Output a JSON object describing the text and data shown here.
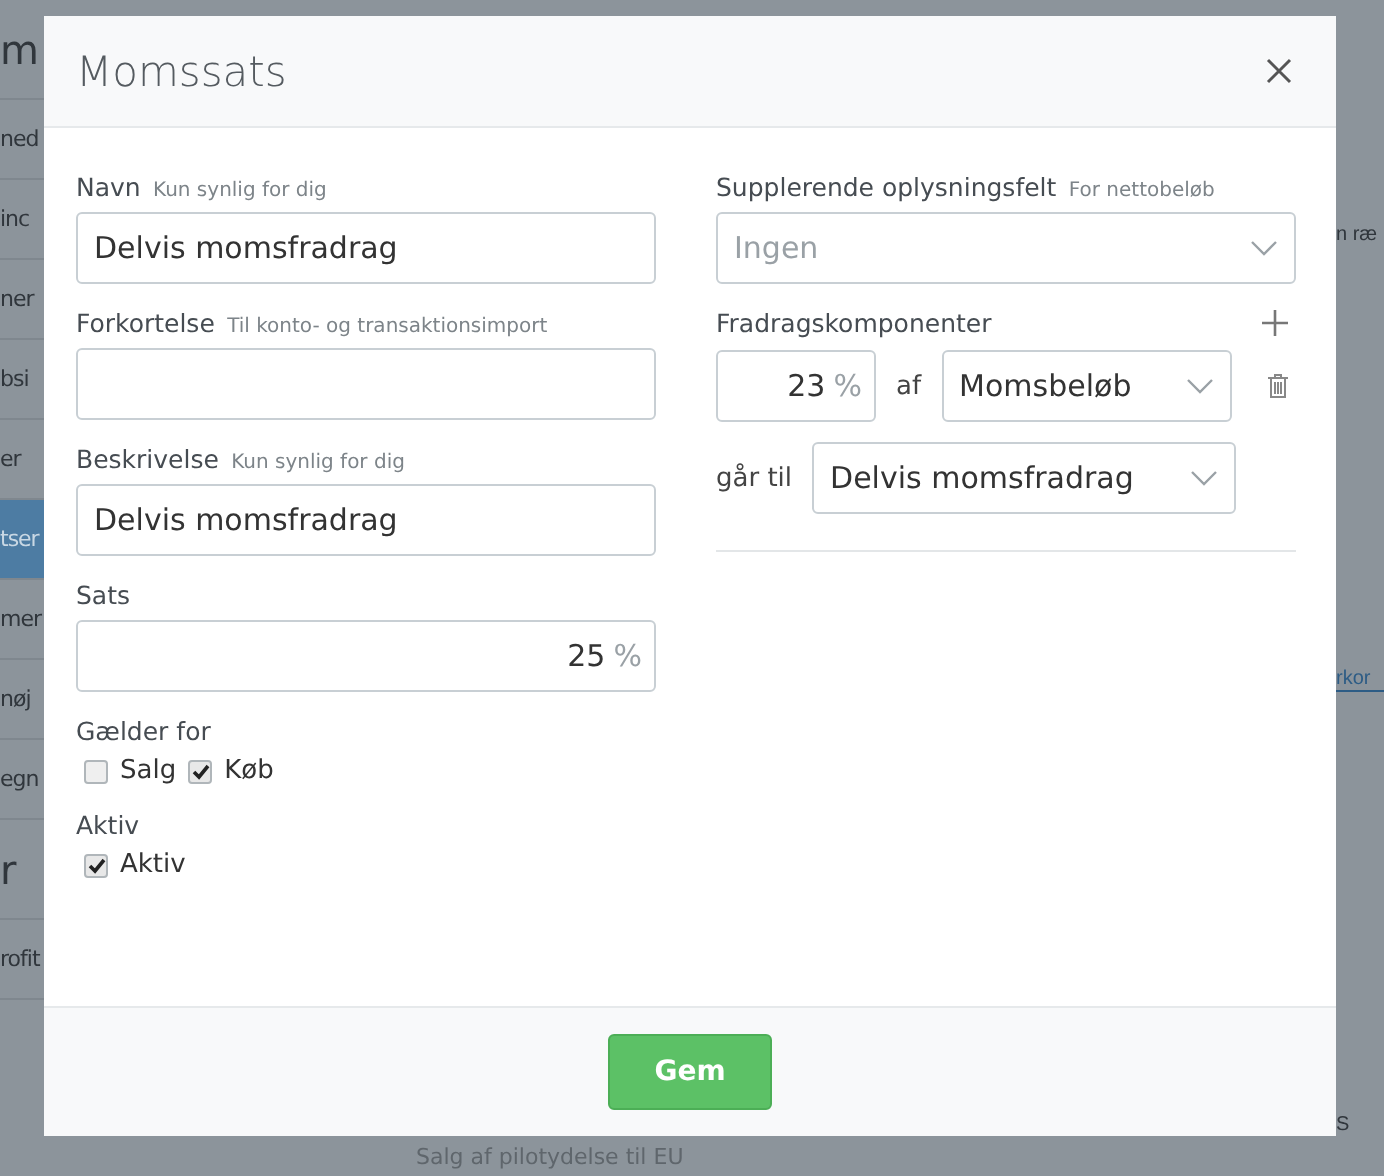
{
  "background": {
    "sidebar_items": [
      {
        "label": "m",
        "kind": "heading",
        "selected": false
      },
      {
        "label": "ned",
        "kind": "item",
        "selected": false
      },
      {
        "label": "inc",
        "kind": "item",
        "selected": false
      },
      {
        "label": "ner",
        "kind": "item",
        "selected": false
      },
      {
        "label": "bsi",
        "kind": "item",
        "selected": false
      },
      {
        "label": "er",
        "kind": "item",
        "selected": false
      },
      {
        "label": "tser",
        "kind": "item",
        "selected": true
      },
      {
        "label": "mer",
        "kind": "item",
        "selected": false
      },
      {
        "label": "nøj",
        "kind": "item",
        "selected": false
      },
      {
        "label": "egn",
        "kind": "item",
        "selected": false
      },
      {
        "label": "r",
        "kind": "heading",
        "selected": false
      },
      {
        "label": "rofit",
        "kind": "item",
        "selected": false
      }
    ],
    "right_items": [
      {
        "label": "n ræ",
        "kind": "text"
      },
      {
        "label": "rkor",
        "kind": "link"
      },
      {
        "label": "S",
        "kind": "text"
      }
    ],
    "bottom_text": "Salg af pilotydelse til EU"
  },
  "dialog": {
    "title": "Momssats",
    "left_fields": [
      {
        "kind": "text",
        "label": "Navn",
        "hint": "Kun synlig for dig",
        "value": "Delvis momsfradrag"
      },
      {
        "kind": "text",
        "label": "Forkortelse",
        "hint": "Til konto- og transaktionsimport"
      },
      {
        "kind": "text",
        "label": "Beskrivelse",
        "hint": "Kun synlig for dig",
        "value": "Delvis momsfradrag"
      },
      {
        "kind": "number",
        "label": "Sats",
        "value": "25",
        "unit": "%"
      },
      {
        "kind": "checks",
        "label": "Gælder for",
        "options": [
          {
            "label": "Salg",
            "checked": false
          },
          {
            "label": "Køb",
            "checked": true
          }
        ]
      },
      {
        "kind": "checks",
        "label": "Aktiv",
        "options": [
          {
            "label": "Aktiv",
            "checked": true
          }
        ]
      }
    ],
    "supplement": {
      "label": "Supplerende oplysningsfelt",
      "hint": "For nettobeløb",
      "placeholder": "Ingen"
    },
    "components": {
      "label": "Fradragskomponenter",
      "items": [
        {
          "percent": "23",
          "unit": "%",
          "of_label": "af",
          "source": "Momsbeløb",
          "goes_to_label": "går til",
          "target": "Delvis momsfradrag"
        }
      ]
    },
    "save_button": "Gem"
  }
}
